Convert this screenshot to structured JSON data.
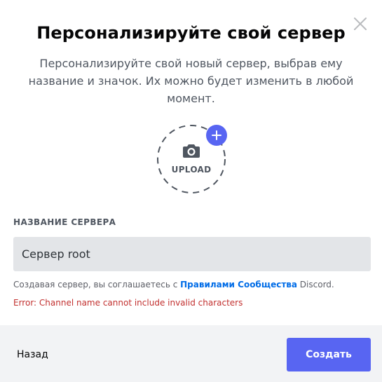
{
  "modal": {
    "title": "Персонализируйте свой сервер",
    "subtitle": "Персонализируйте свой новый сервер, выбрав ему название и значок. Их можно будет изменить в любой момент.",
    "close_icon": "close-icon"
  },
  "upload": {
    "label": "UPLOAD",
    "icon": "camera-icon",
    "badge_icon": "plus-icon"
  },
  "server_name": {
    "label": "НАЗВАНИЕ СЕРВЕРА",
    "value": "Сервер root"
  },
  "terms": {
    "prefix": "Создавая сервер, вы соглашаетесь с ",
    "link": "Правилами Сообщества",
    "suffix": " Discord."
  },
  "error": {
    "text": "Error: Channel name cannot include invalid characters"
  },
  "footer": {
    "back_label": "Назад",
    "create_label": "Создать"
  },
  "colors": {
    "accent": "#5865f2",
    "link": "#006ce7",
    "error": "#c2302f",
    "footer_bg": "#f2f3f5",
    "input_bg": "#e3e5e8"
  }
}
